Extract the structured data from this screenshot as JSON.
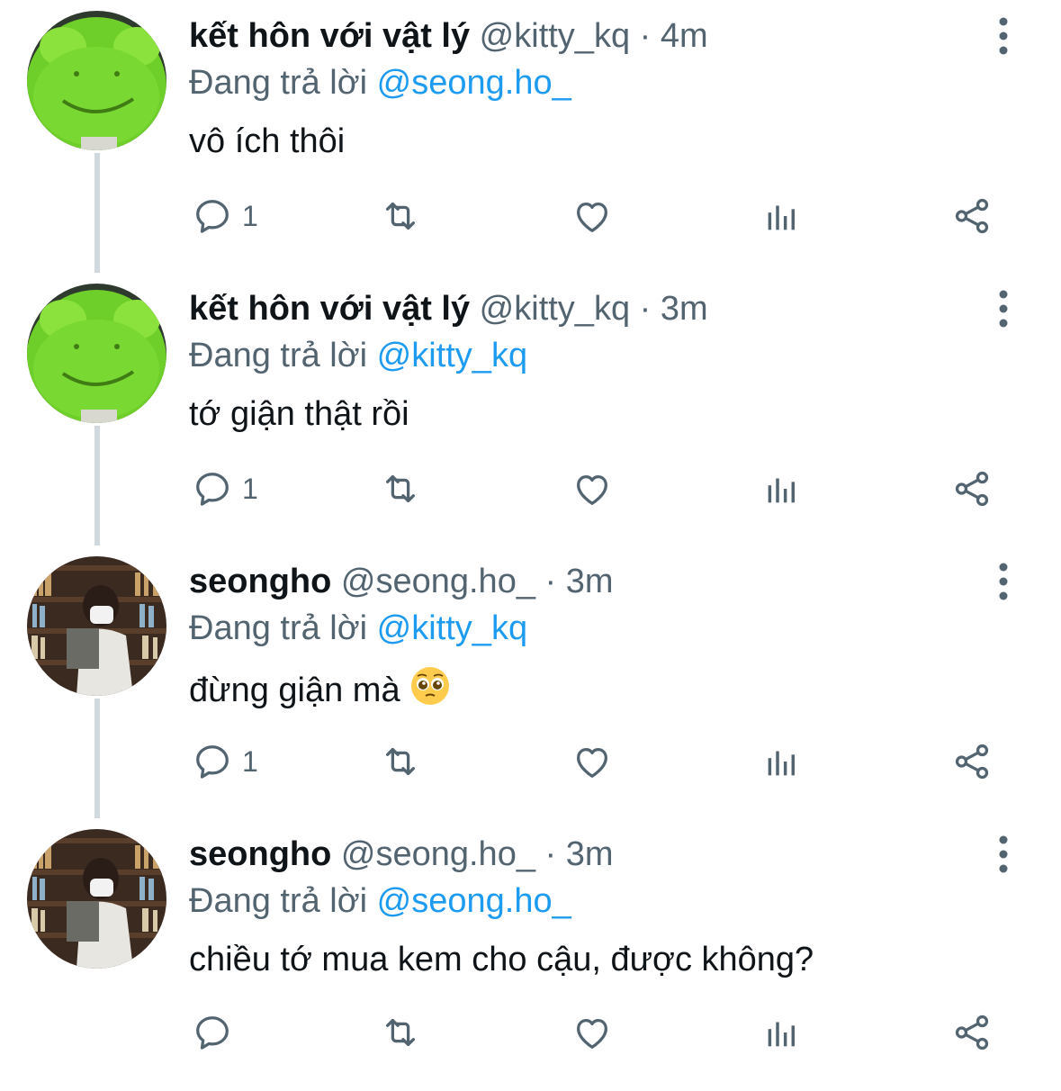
{
  "tweets": [
    {
      "author": "kết hôn với vật lý",
      "handle_time": "@kitty_kq · 4m",
      "reply_prefix": "Đang trả lời",
      "reply_to": "@seong.ho_",
      "text": "vô ích thôi",
      "reply_count": "1",
      "avatar": "frog-avatar"
    },
    {
      "author": "kết hôn với vật lý",
      "handle_time": "@kitty_kq · 3m",
      "reply_prefix": "Đang trả lời",
      "reply_to": "@kitty_kq",
      "text": "tớ giận thật rồi",
      "reply_count": "1",
      "avatar": "frog-avatar"
    },
    {
      "author": "seongho",
      "handle_time": "@seong.ho_ · 3m",
      "reply_prefix": "Đang trả lời",
      "reply_to": "@kitty_kq",
      "text": "đừng giận mà",
      "emoji": "pleading-face-emoji",
      "reply_count": "1",
      "avatar": "library-avatar"
    },
    {
      "author": "seongho",
      "handle_time": "@seong.ho_ · 3m",
      "reply_prefix": "Đang trả lời",
      "reply_to": "@seong.ho_",
      "text": "chiều tớ mua kem cho cậu, được không?",
      "reply_count": "",
      "avatar": "library-avatar"
    }
  ],
  "colors": {
    "text": "#0f1419",
    "secondary": "#536471",
    "link": "#1d9bf0",
    "thread_line": "#cfd9de"
  },
  "icons": [
    "reply-icon",
    "retweet-icon",
    "like-icon",
    "views-icon",
    "share-icon",
    "more-icon"
  ]
}
